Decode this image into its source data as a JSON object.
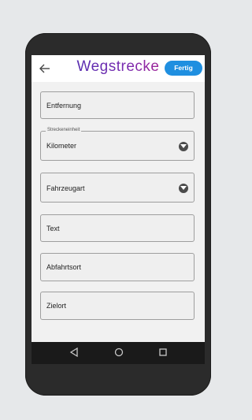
{
  "header": {
    "title": "Wegstrecke",
    "done_label": "Fertig"
  },
  "form": {
    "distance_placeholder": "Entfernung",
    "unit_label": "Streckeneinheit",
    "unit_value": "Kilometer",
    "vehicle_type_value": "Fahrzeugart",
    "text_placeholder": "Text",
    "departure_placeholder": "Abfahrtsort",
    "destination_placeholder": "Zielort"
  },
  "icons": {
    "back": "back-arrow-icon",
    "dropdown": "chevron-down-icon",
    "nav_back": "triangle-back-icon",
    "nav_home": "circle-home-icon",
    "nav_recents": "square-recents-icon"
  },
  "colors": {
    "accent": "#1f8fe0",
    "title_gradient_start": "#3a2fb0",
    "title_gradient_end": "#d0207a",
    "navbar": "#1a1a1a"
  }
}
